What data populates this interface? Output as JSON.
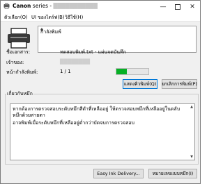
{
  "window": {
    "title_brand": "Canon",
    "title_series": "series -",
    "title_redacted": "███████████"
  },
  "menu": {
    "items": [
      "ตัวเลือก(O)",
      "UI ของไดร์ฟ(B)",
      "วิธีใช้(H)"
    ]
  },
  "status": {
    "message": "กำลังพิมพ์"
  },
  "details": {
    "document_label": "ชื่อเอกสาร:",
    "document_value": "ทดสอบพิมพ์.txt - แผ่นจดบันทึก",
    "owner_label": "เจ้าของ:",
    "owner_value": "████████",
    "pages_label": "หน้ากำลังพิมพ์:",
    "pages_value": "1 / 1",
    "progress_fraction": 0.33
  },
  "buttons": {
    "show_queue": "แสดงคิวพิมพ์(Q)",
    "cancel_printing": "ยกเลิกการพิมพ์(P)",
    "easy_ink_delivery": "Easy Ink Delivery...",
    "ink_model_info": "หมายเลขแบบหมึก(I)"
  },
  "ink": {
    "group_title": "เกี่ยวกับหมึก",
    "lines": [
      "หากต้องการตรวจสอบระดับหมึกสีดำที่เหลืออยู่ ให้ตรวจสอบหมึกที่เหลืออยู่ในตลับหมึกด้วยสายตา",
      "อาจพิมพ์เมื่อระดับหมึกที่เหลืออยู่ต่ำกว่าบัดจบการตรวจสอบ"
    ]
  }
}
